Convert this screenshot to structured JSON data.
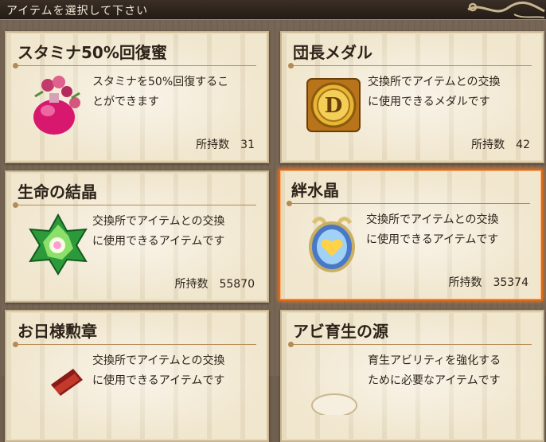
{
  "header": {
    "title": "アイテムを選択して下さい"
  },
  "items": [
    {
      "name": "スタミナ50%回復蜜",
      "desc_line1": "スタミナを50%回復するこ",
      "desc_line2": "とができます",
      "count_label": "所持数",
      "count": "31",
      "icon": "stamina-honey-icon"
    },
    {
      "name": "団長メダル",
      "desc_line1": "交換所でアイテムとの交換",
      "desc_line2": "に使用できるメダルです",
      "count_label": "所持数",
      "count": "42",
      "icon": "captain-medal-icon"
    },
    {
      "name": "生命の結晶",
      "desc_line1": "交換所でアイテムとの交換",
      "desc_line2": "に使用できるアイテムです",
      "count_label": "所持数",
      "count": "55870",
      "icon": "life-crystal-icon"
    },
    {
      "name": "絆水晶",
      "desc_line1": "交換所でアイテムとの交換",
      "desc_line2": "に使用できるアイテムです",
      "count_label": "所持数",
      "count": "35374",
      "icon": "bond-crystal-icon",
      "selected": true
    },
    {
      "name": "お日様勲章",
      "desc_line1": "交換所でアイテムとの交換",
      "desc_line2": "に使用できるアイテムです",
      "icon": "sun-medal-icon"
    },
    {
      "name": "アビ育生の源",
      "desc_line1": "育生アビリティを強化する",
      "desc_line2": "ために必要なアイテムです",
      "icon": "ability-source-icon"
    }
  ]
}
